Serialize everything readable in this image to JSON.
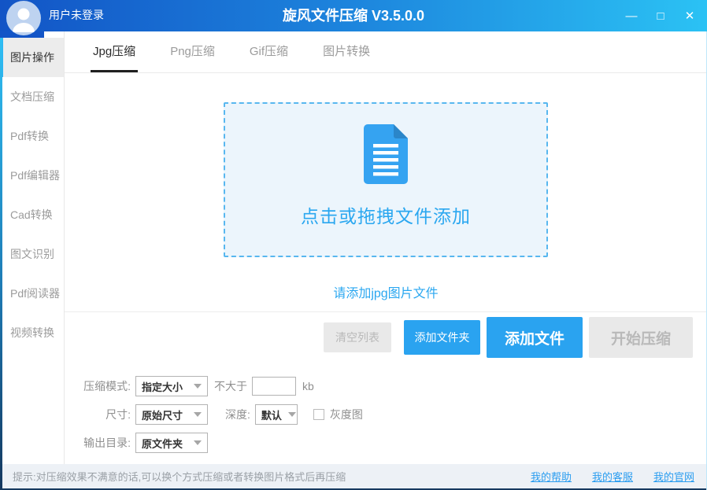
{
  "window": {
    "title": "旋风文件压缩 V3.5.0.0",
    "user_status": "用户未登录",
    "controls": {
      "minimize": "—",
      "maximize": "□",
      "close": "✕"
    }
  },
  "sidebar": {
    "items": [
      {
        "label": "图片操作",
        "active": true
      },
      {
        "label": "文档压缩",
        "active": false
      },
      {
        "label": "Pdf转换",
        "active": false
      },
      {
        "label": "Pdf编辑器",
        "active": false
      },
      {
        "label": "Cad转换",
        "active": false
      },
      {
        "label": "图文识别",
        "active": false
      },
      {
        "label": "Pdf阅读器",
        "active": false
      },
      {
        "label": "视频转换",
        "active": false
      }
    ]
  },
  "tabs": [
    {
      "label": "Jpg压缩",
      "active": true
    },
    {
      "label": "Png压缩",
      "active": false
    },
    {
      "label": "Gif压缩",
      "active": false
    },
    {
      "label": "图片转换",
      "active": false
    }
  ],
  "dropzone": {
    "text": "点击或拖拽文件添加",
    "icon": "document-icon",
    "hint": "请添加jpg图片文件"
  },
  "actions": {
    "clear_list": "清空列表",
    "add_folder": "添加文件夹",
    "add_file": "添加文件",
    "start_compress": "开始压缩"
  },
  "settings": {
    "mode_label": "压缩模式:",
    "mode_value": "指定大小",
    "not_greater_label": "不大于",
    "size_input_value": "",
    "unit_label": "kb",
    "dimension_label": "尺寸:",
    "dimension_value": "原始尺寸",
    "depth_label": "深度:",
    "depth_value": "默认",
    "grayscale_label": "灰度图",
    "grayscale_checked": false,
    "output_label": "输出目录:",
    "output_value": "原文件夹"
  },
  "statusbar": {
    "tip": "提示:对压缩效果不满意的话,可以换个方式压缩或者转换图片格式后再压缩",
    "links": [
      "我的帮助",
      "我的客服",
      "我的官网"
    ]
  },
  "colors": {
    "accent_blue": "#2aa3f0",
    "titlebar_left": "#1254c6",
    "titlebar_right": "#2bc2f4",
    "active_tab_underline": "#1f1f1f",
    "disabled_bg": "#e9e9e9",
    "dropzone_bg": "#ecf5fc",
    "dropzone_border": "#58b7ef",
    "statusbar_bg": "#edf1f6"
  }
}
